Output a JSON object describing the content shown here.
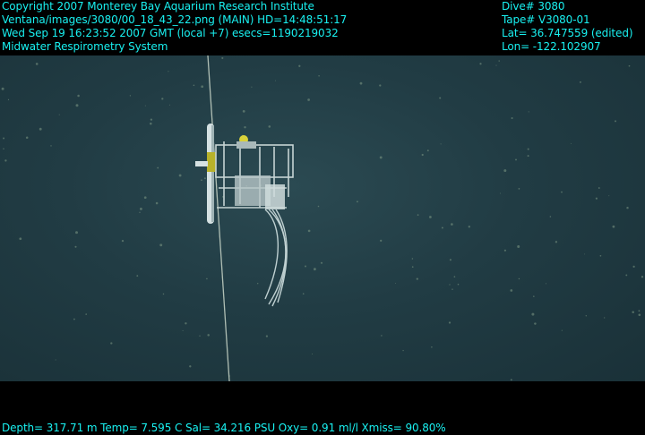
{
  "overlay": {
    "left_lines": [
      "Copyright 2007 Monterey Bay Aquarium Research Institute",
      "Ventana/images/3080/00_18_43_22.png (MAIN)  HD=14:48:51:17",
      "Wed Sep 19 16:23:52 2007 GMT (local +7)  esecs=1190219032",
      "Midwater Respirometry System"
    ],
    "right_lines": [
      "Dive# 3080",
      "Tape# V3080-01",
      "Lat= 36.747559 (edited)",
      "Lon= -122.102907"
    ],
    "bottom_line": "Depth= 317.71 m  Temp= 7.595 C  Sal= 34.216 PSU  Oxy= 0.91 ml/l  Xmiss= 90.80%"
  },
  "colors": {
    "overlay_text": "#19f0f0",
    "water": "#213c44",
    "letterbox": "#000000"
  },
  "scene": {
    "subject": "midwater-respirometry-instrument",
    "tether": "tether-cable"
  }
}
